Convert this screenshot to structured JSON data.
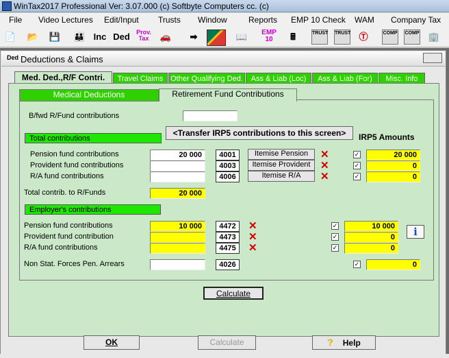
{
  "window": {
    "title": "WinTax2017 Professional Ver: 3.07.000  (c) Softbyte Computers cc. (c)"
  },
  "menu": [
    "File",
    "Video Lectures",
    "Edit/Input",
    "Trusts",
    "Window",
    "Reports",
    "EMP 10 Check",
    "WAM",
    "Company Tax"
  ],
  "toolbar": {
    "inc": "Inc",
    "ded": "Ded",
    "prov_tax": "Prov.\nTax",
    "emp10": "EMP\n10",
    "trust1": "TRUST",
    "trust2": "TRUST",
    "comp1": "COMP",
    "comp2": "COMP"
  },
  "dialog": {
    "title": "Deductions & Claims",
    "icon_label": "Ded",
    "tabs": [
      "Med. Ded.,R/F Contri.",
      "Travel Claims",
      "Other Qualifying Ded.",
      "Ass & Liab (Loc)",
      "Ass & Liab (For)",
      "Misc. Info"
    ],
    "subtabs": [
      "Medical Deductions",
      "Retirement Fund Contributions"
    ],
    "bfwd_label": "B/fwd R/Fund contributions",
    "total_contrib_bar": "Total contributions",
    "transfer_button": "<Transfer IRP5 contributions to this screen>",
    "irp5_heading": "IRP5 Amounts",
    "rows_total": [
      {
        "label": "Pension fund contributions",
        "value": "20 000",
        "code": "4001",
        "button": "Itemise Pension",
        "irp5": "20 000"
      },
      {
        "label": "Provident fund contributions",
        "value": "",
        "code": "4003",
        "button": "Itemise Provident",
        "irp5": "0"
      },
      {
        "label": "R/A fund contributions",
        "value": "",
        "code": "4006",
        "button": "Itemise R/A",
        "irp5": "0"
      }
    ],
    "total_rfunds_label": "Total contrib. to R/Funds",
    "total_rfunds_value": "20 000",
    "employer_bar": "Employer's contributions",
    "rows_employer": [
      {
        "label": "Pension fund contributions",
        "value": "10 000",
        "code": "4472",
        "irp5": "10 000"
      },
      {
        "label": "Provident fund contribution",
        "value": "",
        "code": "4473",
        "irp5": "0"
      },
      {
        "label": "R/A fund contributions",
        "value": "",
        "code": "4475",
        "irp5": "0"
      }
    ],
    "non_stat_label": "Non Stat. Forces Pen. Arrears",
    "non_stat_code": "4026",
    "non_stat_irp5": "0",
    "calculate_button": "Calculate",
    "footer": {
      "ok": "OK",
      "calculate": "Calculate",
      "help": "Help"
    }
  },
  "colors": {
    "tab_green": "#2fd000",
    "panel_green": "#cbe8c8",
    "highlight_yellow": "#ffff00",
    "x_red": "#d40000"
  }
}
